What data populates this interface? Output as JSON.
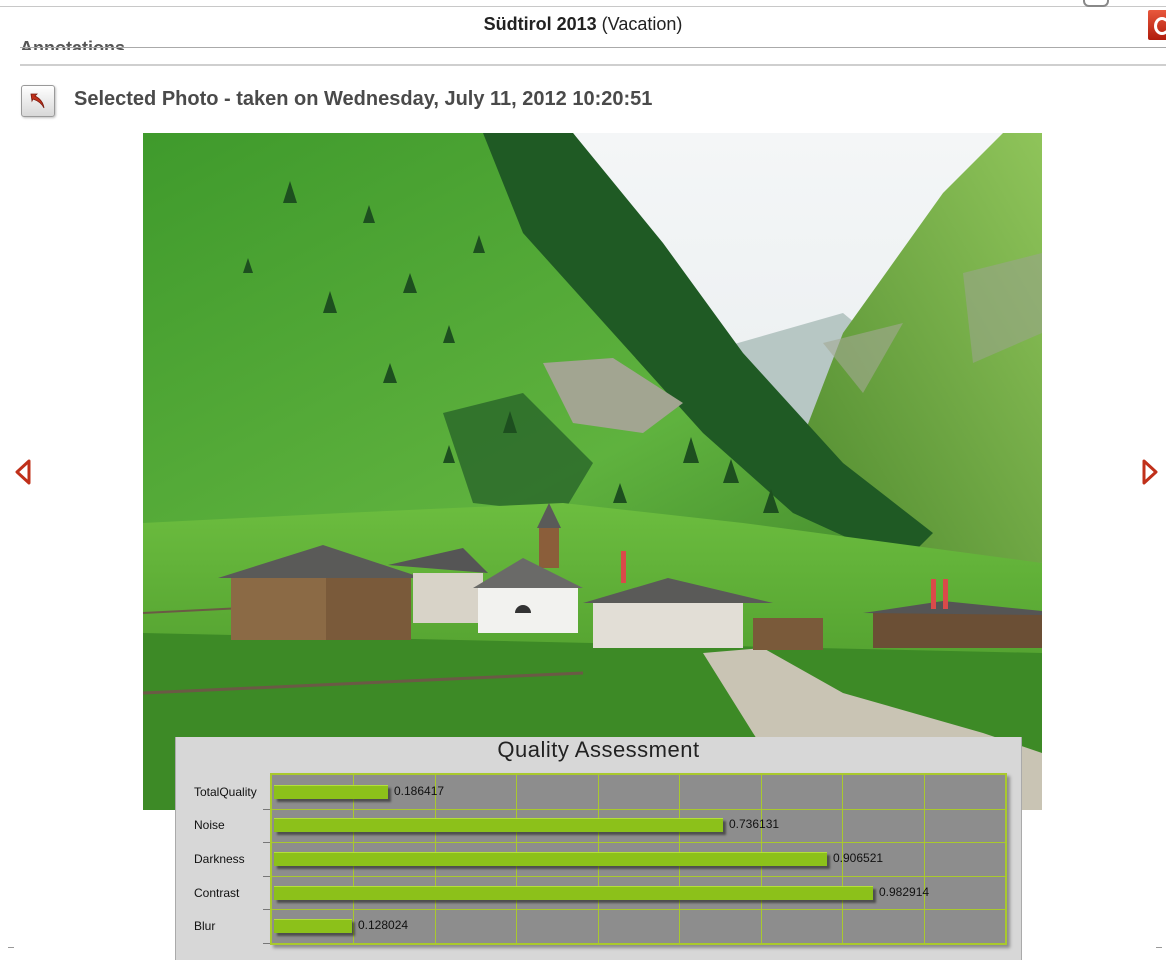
{
  "header": {
    "album_name": "Südtirol 2013",
    "album_type": "(Vacation)"
  },
  "section": {
    "label": "Annotations"
  },
  "photo": {
    "heading": "Selected Photo - taken on Wednesday, July 11, 2012 10:20:51",
    "description": ""
  },
  "icons": {
    "back": "back-arrow-icon",
    "prev": "triangle-left-icon",
    "next": "triangle-right-icon",
    "corner": "power-icon"
  },
  "colors": {
    "accent_red": "#c0301a",
    "bar_green": "#8cc11a",
    "grid_green": "#a9c92d",
    "plot_bg": "#8d8d8d",
    "panel_bg": "#d7d7d7"
  },
  "chart_data": {
    "type": "bar",
    "orientation": "horizontal",
    "title": "Quality Assessment",
    "categories": [
      "TotalQuality",
      "Noise",
      "Darkness",
      "Contrast",
      "Blur"
    ],
    "values": [
      0.186417,
      0.736131,
      0.906521,
      0.982914,
      0.128024
    ],
    "value_labels": [
      "0.186417",
      "0.736131",
      "0.906521",
      "0.982914",
      "0.128024"
    ],
    "xlim": [
      0,
      1
    ],
    "grid": true,
    "xlabel": "",
    "ylabel": ""
  }
}
